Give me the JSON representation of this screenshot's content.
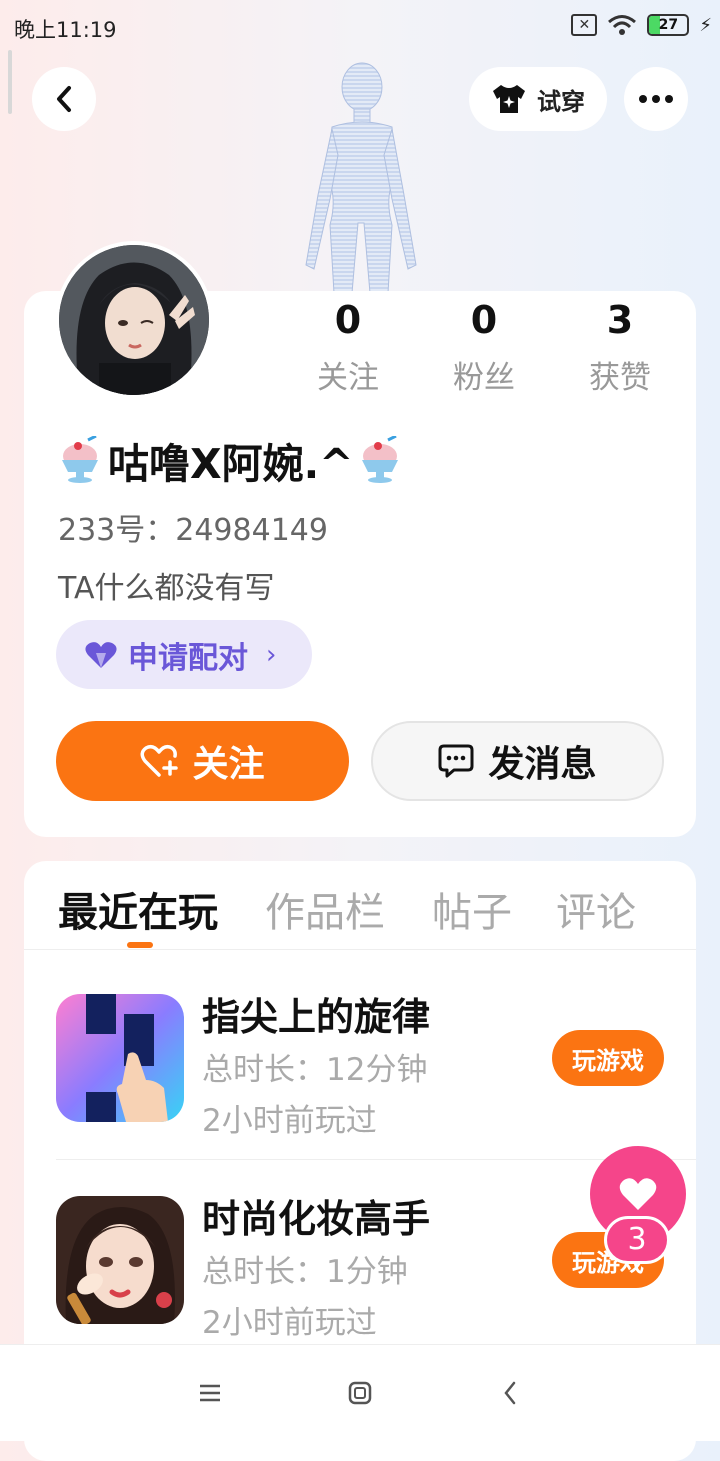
{
  "status_bar": {
    "time": "晚上11:19",
    "battery": "27"
  },
  "header": {
    "tryon_label": "试穿"
  },
  "profile": {
    "stats": [
      {
        "value": "0",
        "label": "关注"
      },
      {
        "value": "0",
        "label": "粉丝"
      },
      {
        "value": "3",
        "label": "获赞"
      }
    ],
    "name": "咕噜X阿婉.^",
    "id_text": "233号：24984149",
    "bio": "TA什么都没有写",
    "pair_label": "申请配对",
    "follow_label": "关注",
    "message_label": "发消息"
  },
  "tabs": [
    {
      "label": "最近在玩",
      "active": true
    },
    {
      "label": "作品栏",
      "active": false
    },
    {
      "label": "帖子",
      "active": false
    },
    {
      "label": "评论",
      "active": false
    }
  ],
  "games": [
    {
      "name": "指尖上的旋律",
      "duration": "总时长：12分钟",
      "last_played": "2小时前玩过",
      "action": "玩游戏"
    },
    {
      "name": "时尚化妆高手",
      "duration": "总时长：1分钟",
      "last_played": "2小时前玩过",
      "action": "玩游戏"
    }
  ],
  "likes": {
    "count": "3"
  },
  "colors": {
    "accent": "#fb7412",
    "pair": "#6a57d8",
    "like": "#f5458a"
  }
}
